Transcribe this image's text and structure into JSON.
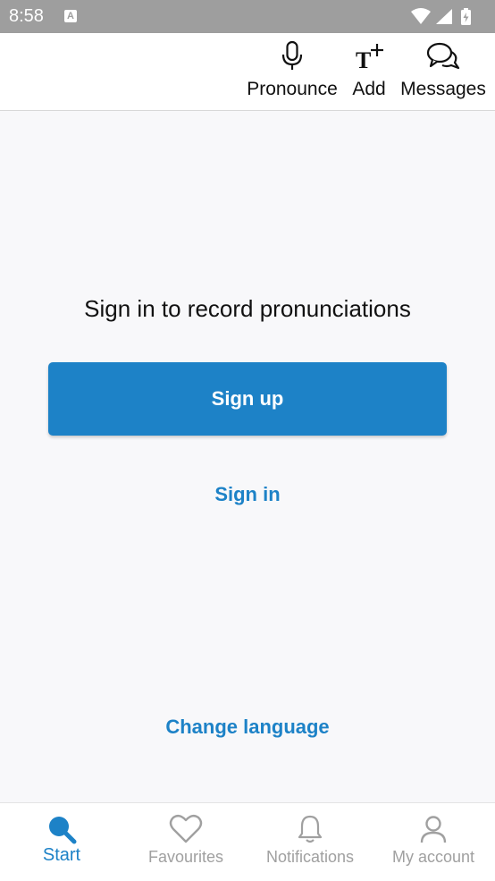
{
  "status_bar": {
    "time": "8:58",
    "app_icon": "A",
    "icons": [
      "wifi-icon",
      "signal-icon",
      "battery-charging-icon"
    ]
  },
  "top_bar": {
    "actions": [
      {
        "label": "Pronounce",
        "icon": "microphone-icon"
      },
      {
        "label": "Add",
        "icon": "add-text-icon"
      },
      {
        "label": "Messages",
        "icon": "chat-bubbles-icon"
      }
    ]
  },
  "main": {
    "message": "Sign in to record pronunciations",
    "signup_label": "Sign up",
    "signin_label": "Sign in",
    "change_language_label": "Change language"
  },
  "bottom_nav": {
    "active": "Start",
    "items": [
      {
        "label": "Start",
        "icon": "search-icon"
      },
      {
        "label": "Favourites",
        "icon": "heart-icon"
      },
      {
        "label": "Notifications",
        "icon": "bell-icon"
      },
      {
        "label": "My account",
        "icon": "user-icon"
      }
    ]
  },
  "colors": {
    "accent": "#1d82c7",
    "status_bar": "#9e9e9e",
    "background": "#f8f8fa",
    "inactive_nav": "#a0a0a0"
  }
}
